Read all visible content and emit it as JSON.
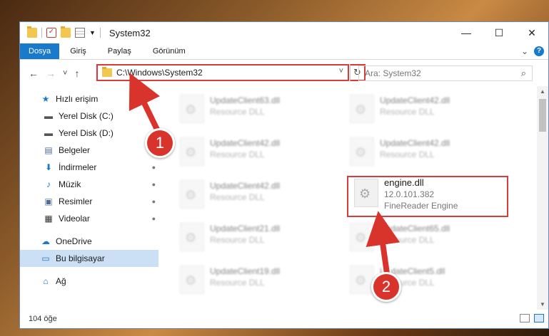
{
  "window": {
    "title": "System32",
    "buttons": {
      "minimize": "—",
      "maximize": "☐",
      "close": "✕"
    }
  },
  "ribbon": {
    "tabs": [
      {
        "label": "Dosya",
        "active": true
      },
      {
        "label": "Giriş"
      },
      {
        "label": "Paylaş"
      },
      {
        "label": "Görünüm"
      }
    ],
    "expand": "⌄",
    "help": "?"
  },
  "nav_buttons": {
    "back": "←",
    "forward": "→",
    "recent": "˅",
    "up": "↑"
  },
  "address": {
    "path": "C:\\Windows\\System32",
    "dropdown": "˅",
    "refresh": "↻"
  },
  "search": {
    "placeholder": "Ara: System32",
    "icon": "⌕"
  },
  "sidebar": {
    "items": [
      {
        "label": "Hızlı erişim",
        "icon": "★",
        "icon_name": "star-icon",
        "color": "#1979ca"
      },
      {
        "label": "Yerel Disk (C:)",
        "icon": "▬",
        "icon_name": "drive-icon",
        "pinned": true,
        "sub": true
      },
      {
        "label": "Yerel Disk (D:)",
        "icon": "▬",
        "icon_name": "drive-icon",
        "pinned": true,
        "sub": true
      },
      {
        "label": "Belgeler",
        "icon": "▤",
        "icon_name": "documents-icon",
        "pinned": true,
        "sub": true
      },
      {
        "label": "İndirmeler",
        "icon": "⬇",
        "icon_name": "download-icon",
        "pinned": true,
        "sub": true
      },
      {
        "label": "Müzik",
        "icon": "♪",
        "icon_name": "music-icon",
        "pinned": true,
        "sub": true
      },
      {
        "label": "Resimler",
        "icon": "▣",
        "icon_name": "pictures-icon",
        "pinned": true,
        "sub": true
      },
      {
        "label": "Videolar",
        "icon": "▦",
        "icon_name": "videos-icon",
        "pinned": true,
        "sub": true
      },
      {
        "label": "OneDrive",
        "icon": "☁",
        "icon_name": "onedrive-icon"
      },
      {
        "label": "Bu bilgisayar",
        "icon": "▭",
        "icon_name": "computer-icon",
        "selected": true
      },
      {
        "label": "Ağ",
        "icon": "⌂",
        "icon_name": "network-icon"
      }
    ],
    "pin_glyph": "📌"
  },
  "files": [
    {
      "name": "UpdateClient63.dll",
      "desc": "Resource DLL",
      "blur": true
    },
    {
      "name": "UpdateClient42.dll",
      "desc": "Resource DLL",
      "blur": true
    },
    {
      "name": "UpdateClient42.dll",
      "desc": "Resource DLL",
      "blur": true
    },
    {
      "name": "UpdateClient42.dll",
      "desc": "Resource DLL",
      "blur": true
    },
    {
      "name": "UpdateClient42.dll",
      "desc": "Resource DLL",
      "blur": true
    },
    {
      "name": "engine.dll",
      "version": "12.0.101.382",
      "desc": "FineReader Engine",
      "blur": false
    },
    {
      "name": "UpdateClient21.dll",
      "desc": "Resource DLL",
      "blur": true
    },
    {
      "name": "UpdateClient65.dll",
      "desc": "Resource DLL",
      "blur": true
    },
    {
      "name": "UpdateClient19.dll",
      "desc": "Resource DLL",
      "blur": true
    },
    {
      "name": "UpdateClient5.dll",
      "desc": "Resource DLL",
      "blur": true
    }
  ],
  "status": {
    "item_count": "104 öğe"
  },
  "annotations": {
    "step1": "1",
    "step2": "2",
    "color": "#d9342b"
  }
}
